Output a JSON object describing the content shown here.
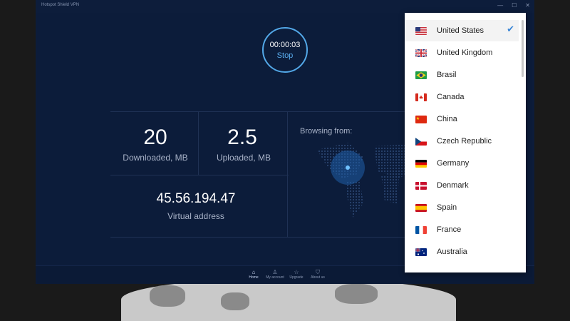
{
  "window": {
    "title": "Hotspot Shield VPN",
    "controls": [
      "—",
      "☐",
      "✕"
    ]
  },
  "timer": {
    "elapsed": "00:00:03",
    "stop_label": "Stop"
  },
  "stats": {
    "downloaded": {
      "value": "20",
      "label": "Downloaded, MB"
    },
    "uploaded": {
      "value": "2.5",
      "label": "Uploaded, MB"
    },
    "virtual_address": {
      "value": "45.56.194.47",
      "label": "Virtual address"
    }
  },
  "browsing_from": {
    "label": "Browsing from:"
  },
  "nav": {
    "items": [
      {
        "label": "Home",
        "icon": "home-icon"
      },
      {
        "label": "My account",
        "icon": "user-icon"
      },
      {
        "label": "Upgrade",
        "icon": "star-icon"
      },
      {
        "label": "About us",
        "icon": "shield-icon"
      }
    ]
  },
  "countries": {
    "selected": "United States",
    "items": [
      {
        "name": "United States",
        "flag": "us-flag-icon"
      },
      {
        "name": "United Kingdom",
        "flag": "uk-flag-icon"
      },
      {
        "name": "Brasil",
        "flag": "brazil-flag-icon"
      },
      {
        "name": "Canada",
        "flag": "canada-flag-icon"
      },
      {
        "name": "China",
        "flag": "china-flag-icon"
      },
      {
        "name": "Czech Republic",
        "flag": "czech-flag-icon"
      },
      {
        "name": "Germany",
        "flag": "germany-flag-icon"
      },
      {
        "name": "Denmark",
        "flag": "denmark-flag-icon"
      },
      {
        "name": "Spain",
        "flag": "spain-flag-icon"
      },
      {
        "name": "France",
        "flag": "france-flag-icon"
      },
      {
        "name": "Australia",
        "flag": "australia-flag-icon"
      }
    ]
  },
  "colors": {
    "background": "#0c1c3a",
    "accent": "#53a8e8",
    "check": "#3a86d6"
  }
}
